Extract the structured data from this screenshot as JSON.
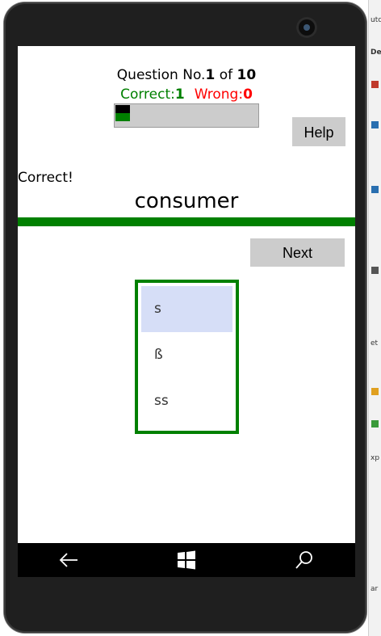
{
  "quiz": {
    "question_prefix": "Question No.",
    "question_number": "1",
    "question_of": "of",
    "question_total": "10",
    "correct_label": "Correct:",
    "correct_count": "1",
    "wrong_label": "Wrong:",
    "wrong_count": "0",
    "progress": {
      "answered_fraction": 0.1,
      "wrong_fraction": 0.0
    },
    "feedback": "Correct!",
    "word": "consumer",
    "help_label": "Help",
    "next_label": "Next",
    "choices": [
      "s",
      "ß",
      "ss"
    ],
    "selected_choice": "s"
  },
  "colors": {
    "correct": "#008000",
    "wrong": "#ff0000",
    "button_bg": "#cccccc",
    "selected_choice_bg": "#d6def7"
  },
  "navbar": {
    "back": "back-arrow-icon",
    "home": "windows-logo-icon",
    "search": "search-icon"
  },
  "background_window_fragments": [
    "utc",
    "Dep",
    "et",
    "xp",
    "ar"
  ]
}
